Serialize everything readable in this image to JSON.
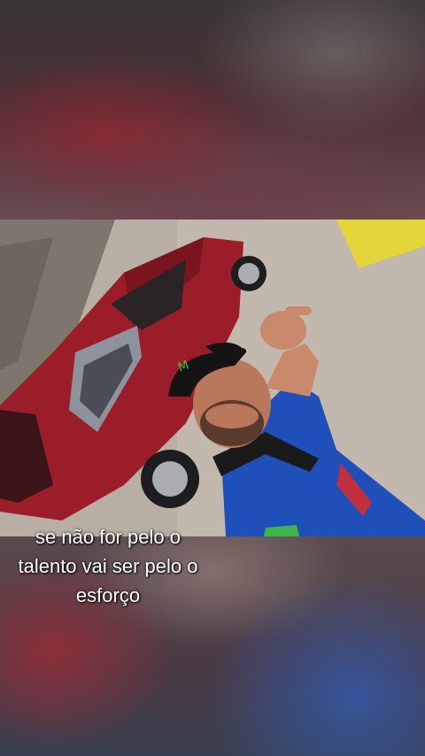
{
  "caption": {
    "lines": [
      "se não for pelo o",
      "talento vai ser pelo o",
      "esforço"
    ]
  },
  "photo": {
    "subject": "man in blue jersey and black cap giving thumbs up next to red car",
    "colors": {
      "car": "#9c1d2a",
      "shirt": "#1f4fb8",
      "ground": "#b9aea4",
      "yellow_wall": "#e2d53a"
    }
  }
}
